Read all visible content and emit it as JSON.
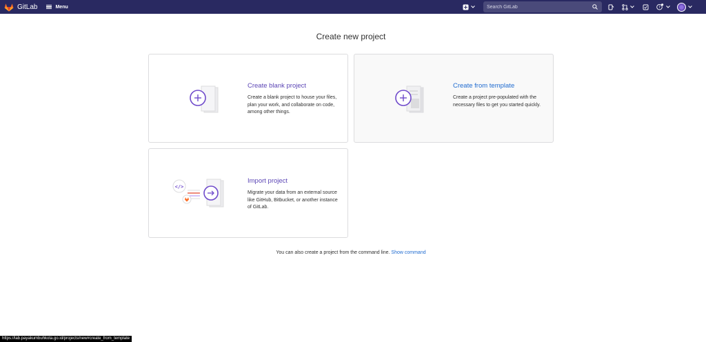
{
  "navbar": {
    "brand": "GitLab",
    "menu_label": "Menu",
    "search_placeholder": "Search GitLab",
    "icons": [
      "gitlab-logo",
      "menu-icon",
      "plus-square-icon",
      "chevron-down-icon",
      "search-icon",
      "issues-icon",
      "merge-request-icon",
      "todo-icon",
      "help-icon",
      "avatar"
    ],
    "colors": {
      "background": "#292961",
      "search_bg": "#4a4a7a",
      "avatar": "#6b4fbb"
    }
  },
  "main": {
    "title": "Create new project",
    "cards": [
      {
        "id": "blank",
        "title": "Create blank project",
        "description": "Create a blank project to house your files, plan your work, and collaborate on code, among other things."
      },
      {
        "id": "template",
        "title": "Create from template",
        "description": "Create a project pre-populated with the necessary files to get you started quickly."
      },
      {
        "id": "import",
        "title": "Import project",
        "description": "Migrate your data from an external source like GitHub, Bitbucket, or another instance of GitLab."
      }
    ],
    "cli_note": "You can also create a project from the command line.",
    "cli_link": "Show command"
  },
  "status_bar": {
    "url": "https://lab.payakumbuhkota.go.id/projects/new#create_from_template"
  },
  "colors": {
    "title_purple": "#5b45b5",
    "title_blue": "#1f6bd0",
    "accent_purple": "#6e49cb",
    "border": "#dcdcde"
  }
}
